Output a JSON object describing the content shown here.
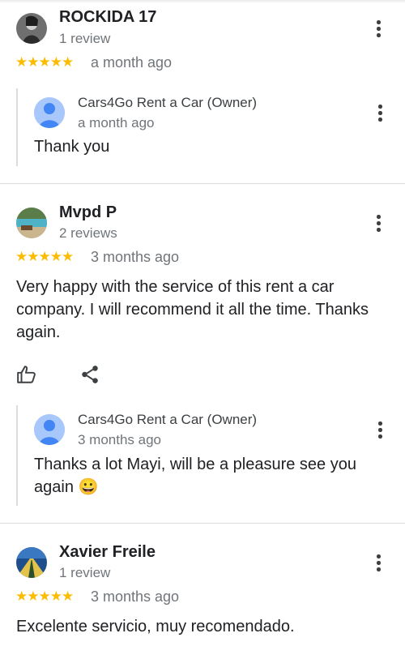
{
  "colors": {
    "star": "#fbbc04",
    "secondary_text": "#70757a",
    "divider": "#dadce0"
  },
  "reviews": [
    {
      "name": "ROCKIDA 17",
      "count": "1 review",
      "stars": "★★★★★",
      "date": "a month ago",
      "text": "",
      "reply": {
        "owner": "Cars4Go Rent a Car (Owner)",
        "date": "a month ago",
        "text": "Thank you"
      }
    },
    {
      "name": "Mvpd P",
      "count": "2 reviews",
      "stars": "★★★★★",
      "date": "3 months ago",
      "text": "Very happy with the service of this rent a car company. I will recommend it all the time. Thanks again.",
      "reply": {
        "owner": "Cars4Go Rent a Car (Owner)",
        "date": "3 months ago",
        "text": "Thanks a lot Mayi, will be a pleasure see you again 😀"
      }
    },
    {
      "name": "Xavier Freile",
      "count": "1 review",
      "stars": "★★★★★",
      "date": "3 months ago",
      "text": "Excelente servicio, muy recomendado."
    }
  ]
}
